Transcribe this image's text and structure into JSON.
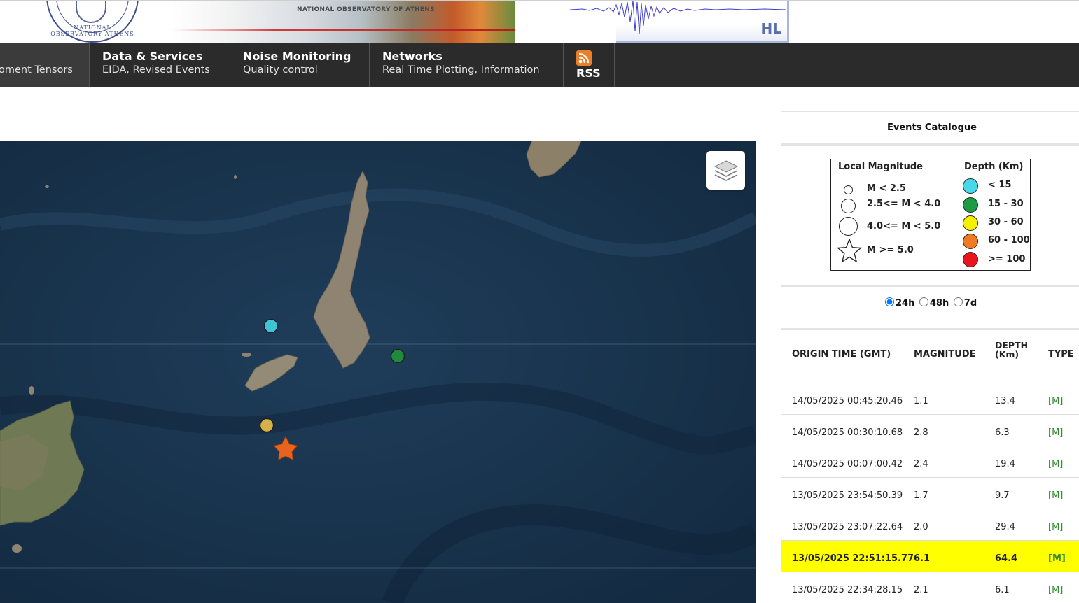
{
  "header": {
    "seal_text": "NATIONAL OBSERVATORY ATHENS",
    "banner_text": "NATIONAL OBSERVATORY OF ATHENS",
    "network_code": "HL"
  },
  "nav": {
    "items": [
      {
        "title": "",
        "subtitle": "oment Tensors"
      },
      {
        "title": "Data & Services",
        "subtitle": "EIDA, Revised Events"
      },
      {
        "title": "Noise Monitoring",
        "subtitle": "Quality control"
      },
      {
        "title": "Networks",
        "subtitle": "Real Time Plotting, Information"
      }
    ],
    "rss_label": "RSS"
  },
  "map": {
    "layers_icon": "layers-icon",
    "events": [
      {
        "shape": "circle",
        "color": "#3fc3d6",
        "label": "cyan-event"
      },
      {
        "shape": "circle",
        "color": "#1e8a3c",
        "label": "green-event"
      },
      {
        "shape": "circle",
        "color": "#d6b14a",
        "label": "yellow-event"
      },
      {
        "shape": "star",
        "color": "#e8641e",
        "label": "star-event"
      }
    ]
  },
  "catalogue": {
    "title": "Events Catalogue",
    "legend": {
      "magnitude_heading": "Local Magnitude",
      "magnitude_items": [
        "M < 2.5",
        "2.5<= M < 4.0",
        "4.0<= M < 5.0",
        "M >= 5.0"
      ],
      "depth_heading": "Depth (Km)",
      "depth_items": [
        {
          "label": "< 15",
          "color": "#48d8e8"
        },
        {
          "label": "15 - 30",
          "color": "#1e9a44"
        },
        {
          "label": "30 - 60",
          "color": "#f5f000"
        },
        {
          "label": "60 - 100",
          "color": "#f07a22"
        },
        {
          "label": ">= 100",
          "color": "#e8141e"
        }
      ]
    },
    "periods": [
      {
        "label": "24h",
        "checked": true
      },
      {
        "label": "48h",
        "checked": false
      },
      {
        "label": "7d",
        "checked": false
      }
    ],
    "columns": {
      "origin": "ORIGIN TIME (GMT)",
      "magnitude": "MAGNITUDE",
      "depth_line1": "DEPTH",
      "depth_line2": "(Km)",
      "type": "TYPE"
    },
    "rows": [
      {
        "time": "14/05/2025 00:45:20.46",
        "mag": "1.1",
        "depth": "13.4",
        "type": "[M]",
        "highlight": false
      },
      {
        "time": "14/05/2025 00:30:10.68",
        "mag": "2.8",
        "depth": "6.3",
        "type": "[M]",
        "highlight": false
      },
      {
        "time": "14/05/2025 00:07:00.42",
        "mag": "2.4",
        "depth": "19.4",
        "type": "[M]",
        "highlight": false
      },
      {
        "time": "13/05/2025 23:54:50.39",
        "mag": "1.7",
        "depth": "9.7",
        "type": "[M]",
        "highlight": false
      },
      {
        "time": "13/05/2025 23:07:22.64",
        "mag": "2.0",
        "depth": "29.4",
        "type": "[M]",
        "highlight": false
      },
      {
        "time": "13/05/2025 22:51:15.77",
        "mag": "6.1",
        "depth": "64.4",
        "type": "[M]",
        "highlight": true
      },
      {
        "time": "13/05/2025 22:34:28.15",
        "mag": "2.1",
        "depth": "6.1",
        "type": "[M]",
        "highlight": false
      }
    ]
  }
}
